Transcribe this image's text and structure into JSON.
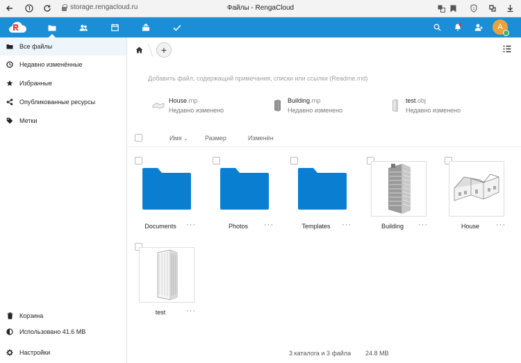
{
  "browser": {
    "url": "storage.rengacloud.ru",
    "title": "Файлы - RengaCloud"
  },
  "colors": {
    "brand": "#1a8ed6",
    "folder": "#0a7fd1",
    "avatar": "#e9a33b",
    "online": "#4caf50"
  },
  "header": {
    "avatar_letter": "A",
    "nav": [
      "files-icon",
      "contacts-icon",
      "calendar-icon",
      "deck-icon",
      "tasks-icon"
    ],
    "right_icons": [
      "search-icon",
      "notifications-icon",
      "contacts-menu-icon"
    ]
  },
  "sidebar": {
    "items": [
      {
        "label": "Все файлы",
        "icon": "folder-icon"
      },
      {
        "label": "Недавно изменённые",
        "icon": "clock-icon"
      },
      {
        "label": "Избранные",
        "icon": "star-icon"
      },
      {
        "label": "Опубликованные ресурсы",
        "icon": "share-icon"
      },
      {
        "label": "Метки",
        "icon": "tag-icon"
      }
    ],
    "bottom": [
      {
        "label": "Корзина",
        "icon": "trash-icon"
      },
      {
        "label": "Использовано 41.6 MB",
        "icon": "quota-icon"
      },
      {
        "label": "Настройки",
        "icon": "gear-icon"
      }
    ]
  },
  "main": {
    "readme_placeholder": "Добавить файл, содержащий примечания, списки или ссылки (Readme.md)",
    "recent": [
      {
        "name": "House",
        "ext": ".rnp",
        "sub": "Недавно изменено"
      },
      {
        "name": "Building",
        "ext": ".rnp",
        "sub": "Недавно изменено"
      },
      {
        "name": "test",
        "ext": ".obj",
        "sub": "Недавно изменено"
      }
    ],
    "columns": {
      "name": "Имя",
      "size": "Размер",
      "modified": "Изменён"
    },
    "files": [
      {
        "name": "Documents",
        "type": "folder"
      },
      {
        "name": "Photos",
        "type": "folder"
      },
      {
        "name": "Templates",
        "type": "folder"
      },
      {
        "name": "Building",
        "type": "building"
      },
      {
        "name": "House",
        "type": "house"
      },
      {
        "name": "test",
        "type": "tower"
      }
    ],
    "more": "···",
    "summary": {
      "count": "3 каталога и 3 файла",
      "size": "24.8 MB"
    }
  }
}
